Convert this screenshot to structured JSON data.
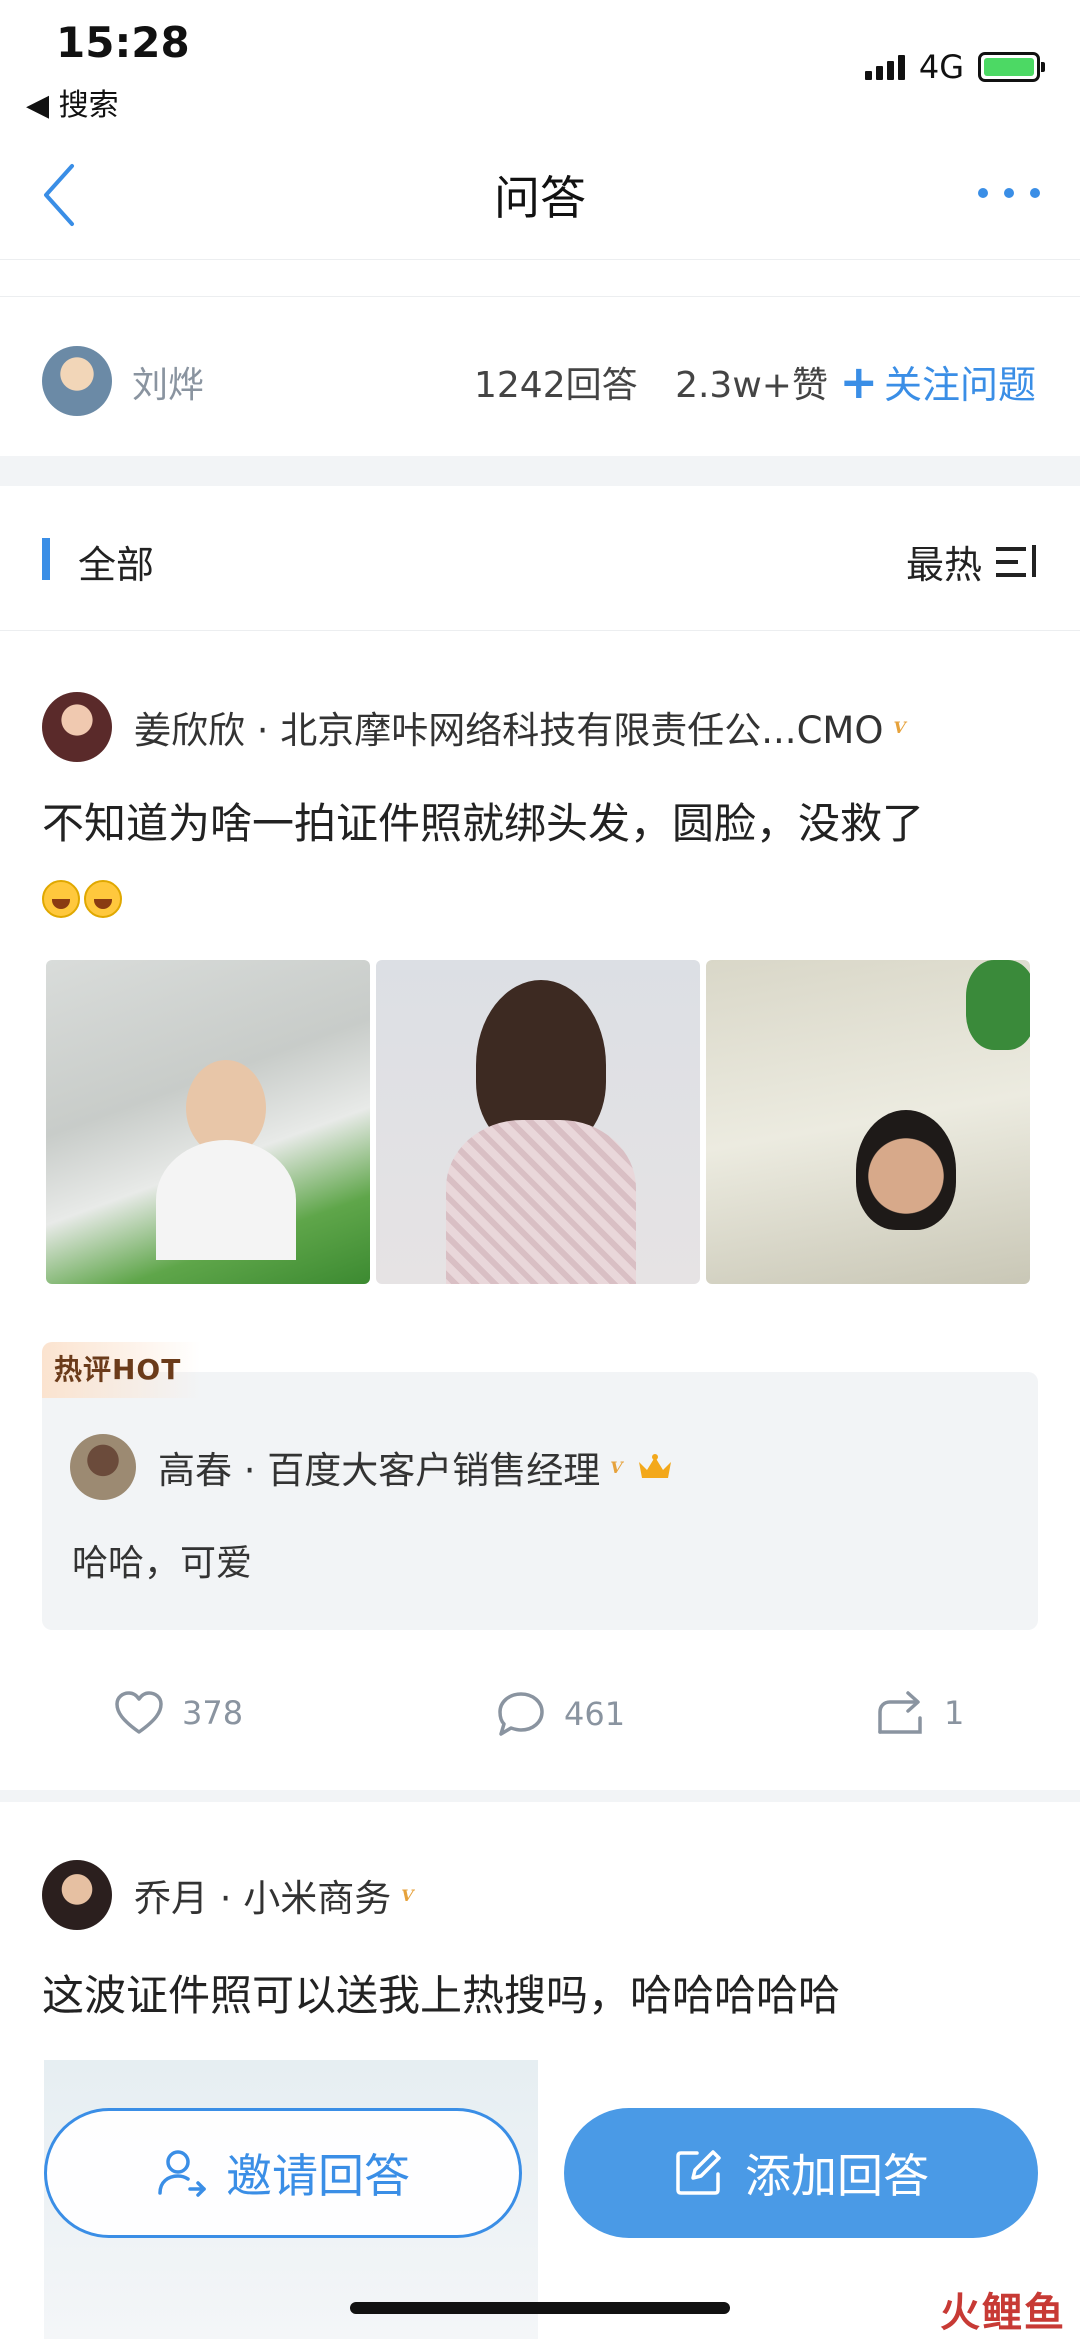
{
  "status_bar": {
    "time": "15:28",
    "back_app": "◀ 搜索",
    "network": "4G"
  },
  "nav": {
    "title": "问答"
  },
  "question": {
    "asker_name": "刘烨",
    "answers_count": "1242回答",
    "likes_count": "2.3w+赞",
    "follow_label": "关注问题"
  },
  "filter": {
    "label": "全部",
    "sort_label": "最热"
  },
  "answers": [
    {
      "author": "姜欣欣 · 北京摩咔网络科技有限责任公...CMO",
      "verified": "V",
      "content": "不知道为啥一拍证件照就绑头发，圆脸，没救了",
      "hot_tag": "热评HOT",
      "hot_comment": {
        "author": "高春 · 百度大客户销售经理",
        "verified": "V",
        "text": "哈哈，可爱"
      },
      "likes": "378",
      "comments": "461",
      "shares": "1"
    },
    {
      "author": "乔月 · 小米商务",
      "verified": "V",
      "content": "这波证件照可以送我上热搜吗，哈哈哈哈哈"
    }
  ],
  "bottom": {
    "invite_label": "邀请回答",
    "add_label": "添加回答"
  },
  "watermark": "火鲤鱼",
  "colors": {
    "accent": "#3a8ee6",
    "verified": "#e6a23c",
    "divider": "#f2f4f6"
  }
}
